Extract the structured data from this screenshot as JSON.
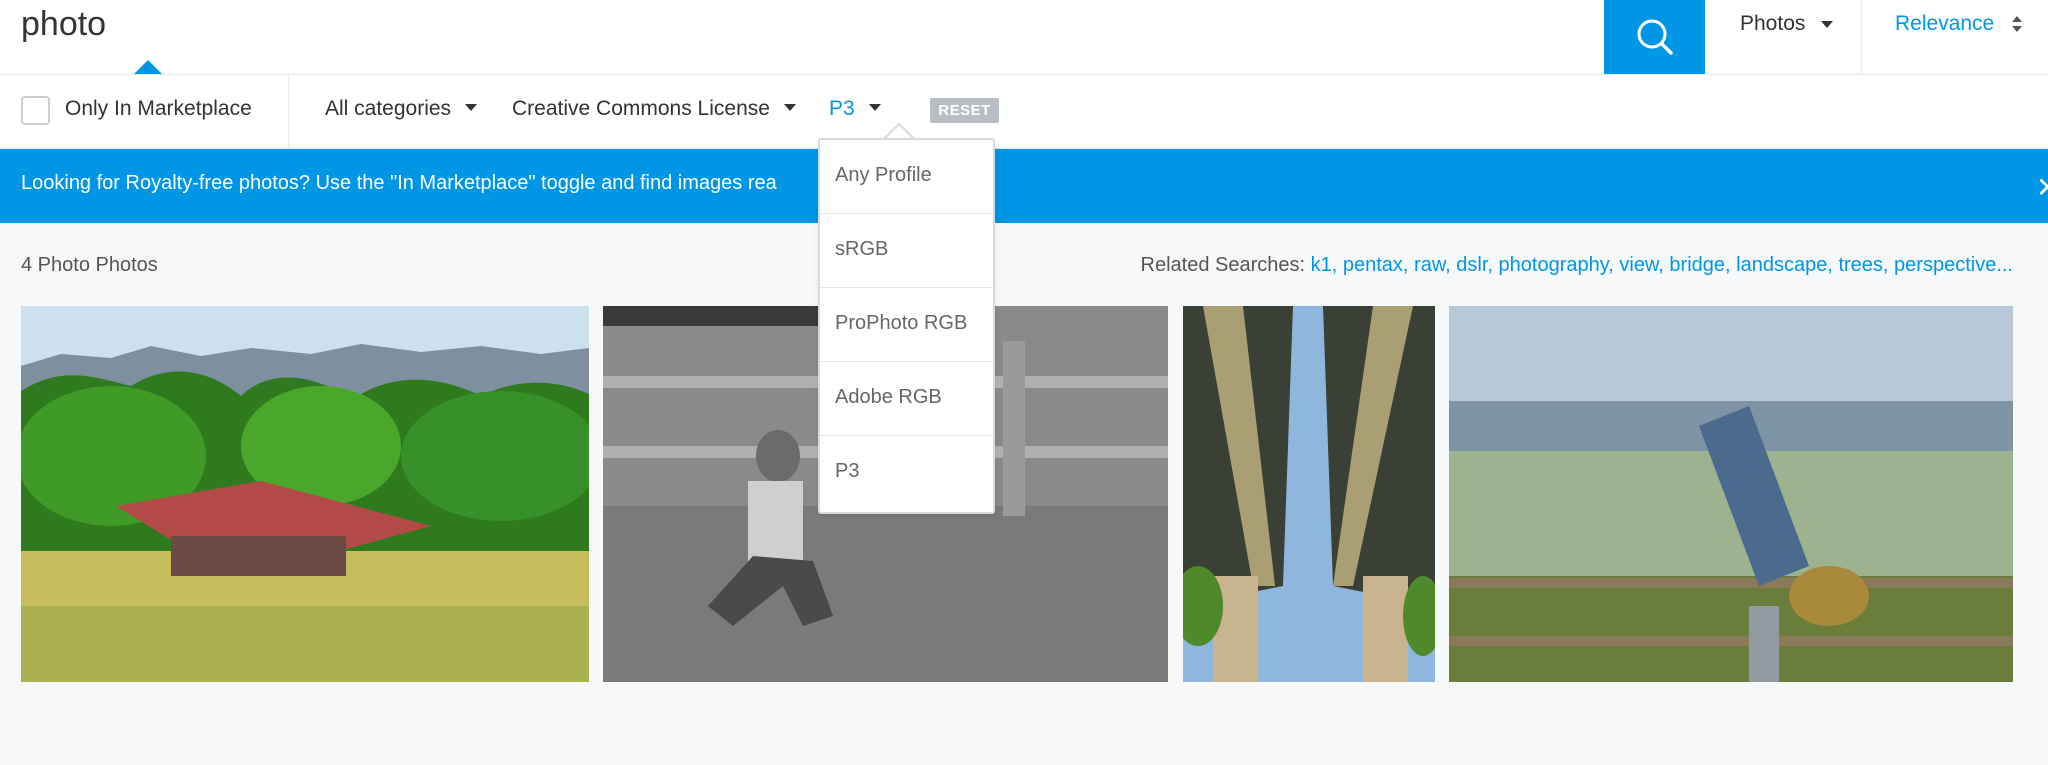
{
  "search": {
    "value": "photo"
  },
  "header": {
    "type_label": "Photos",
    "sort_label": "Relevance"
  },
  "filters": {
    "marketplace_label": "Only In Marketplace",
    "category_label": "All categories",
    "license_label": "Creative Commons License",
    "profile_label": "P3",
    "reset_label": "RESET"
  },
  "banner": {
    "text": "Looking for Royalty-free photos? Use the \"In Marketplace\" toggle and find images rea",
    "close_glyph": "✕"
  },
  "results": {
    "count_text": "4 Photo Photos",
    "related_label": "Related Searches:",
    "related_terms": [
      "k1,",
      "pentax,",
      "raw,",
      "dslr,",
      "photography,",
      "view,",
      "bridge,",
      "landscape,",
      "trees,",
      "perspective..."
    ]
  },
  "profile_dropdown": {
    "options": [
      "Any Profile",
      "sRGB",
      "ProPhoto RGB",
      "Adobe RGB",
      "P3"
    ]
  },
  "colors": {
    "accent": "#0096e6",
    "reset_bg": "#b9bec4",
    "page_bg": "#f7f8fa"
  },
  "icons": {
    "search_button": "search-icon",
    "sort": "sort-arrows-icon",
    "dropdown": "caret-down-icon",
    "banner_close": "close-icon"
  }
}
